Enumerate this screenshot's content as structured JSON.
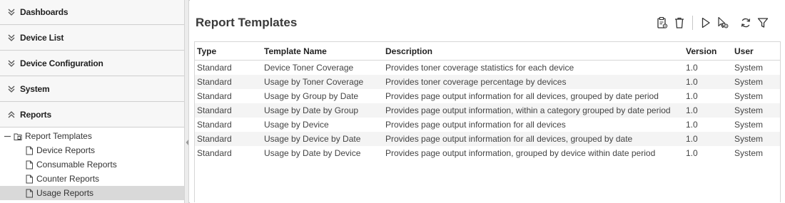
{
  "sidebar": {
    "sections": [
      {
        "label": "Dashboards",
        "state": "collapsed"
      },
      {
        "label": "Device List",
        "state": "collapsed"
      },
      {
        "label": "Device Configuration",
        "state": "collapsed"
      },
      {
        "label": "System",
        "state": "collapsed"
      },
      {
        "label": "Reports",
        "state": "expanded"
      }
    ],
    "tree": {
      "root_label": "Report Templates",
      "children": [
        {
          "label": "Device Reports"
        },
        {
          "label": "Consumable Reports"
        },
        {
          "label": "Counter Reports"
        },
        {
          "label": "Usage Reports"
        }
      ],
      "selected": "Usage Reports"
    }
  },
  "main": {
    "title": "Report Templates",
    "toolbar": {
      "icons": [
        "clipboard-settings-icon",
        "trash-icon",
        "play-icon",
        "cursor-settings-icon",
        "refresh-icon",
        "filter-icon"
      ]
    },
    "table": {
      "columns": [
        "Type",
        "Template Name",
        "Description",
        "Version",
        "User"
      ],
      "rows": [
        [
          "Standard",
          "Device Toner Coverage",
          "Provides toner coverage statistics for each device",
          "1.0",
          "System"
        ],
        [
          "Standard",
          "Usage by Toner Coverage",
          "Provides toner coverage percentage by devices",
          "1.0",
          "System"
        ],
        [
          "Standard",
          "Usage by Group by Date",
          "Provides page output information for all devices, grouped by date period",
          "1.0",
          "System"
        ],
        [
          "Standard",
          "Usage by Date by Group",
          "Provides page output information, within a category grouped by date period",
          "1.0",
          "System"
        ],
        [
          "Standard",
          "Usage by Device",
          "Provides page output information for all devices",
          "1.0",
          "System"
        ],
        [
          "Standard",
          "Usage by Device by Date",
          "Provides page output information for all devices, grouped by date",
          "1.0",
          "System"
        ],
        [
          "Standard",
          "Usage by Date by Device",
          "Provides page output information, grouped by device within date period",
          "1.0",
          "System"
        ]
      ]
    }
  },
  "colors": {
    "sidebar_bg": "#f5f5f5",
    "selected_row": "#d9d9d9",
    "alt_row": "#f4f4f4",
    "border": "#d6d6d6"
  }
}
